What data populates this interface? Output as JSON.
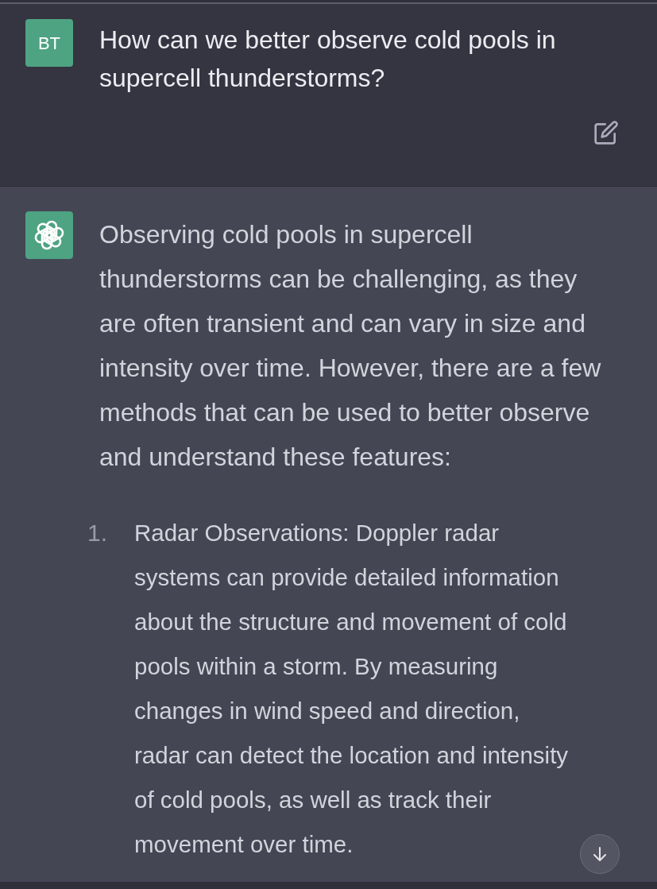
{
  "messages": [
    {
      "kind": "user",
      "avatar": "BT",
      "text": "How can we better observe cold pools in supercell thunderstorms?"
    },
    {
      "kind": "assistant",
      "paragraph": "Observing cold pools in supercell thunderstorms can be challenging, as they are often transient and can vary in size and intensity over time. However, there are a few methods that can be used to better observe and understand these features:",
      "list": [
        {
          "marker": "1.",
          "text": "Radar Observations: Doppler radar systems can provide detailed information about the structure and movement of cold pools within a storm. By measuring changes in wind speed and direction, radar can detect the location and intensity of cold pools, as well as track their movement over time."
        }
      ]
    }
  ]
}
